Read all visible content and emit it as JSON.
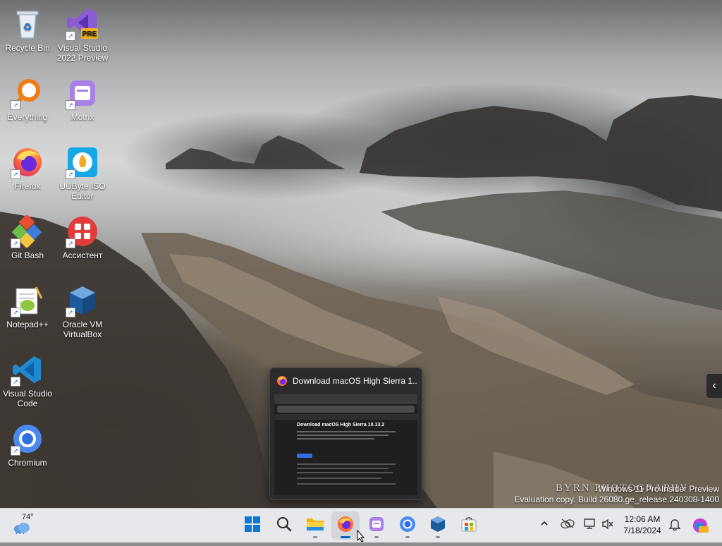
{
  "desktop": {
    "icons": [
      {
        "label": "Recycle Bin",
        "shortcut": false
      },
      {
        "label": "Visual Studio 2022 Preview",
        "shortcut": true,
        "badge": "PRE"
      },
      {
        "label": "Everything",
        "shortcut": true
      },
      {
        "label": "Motrix",
        "shortcut": true
      },
      {
        "label": "Firefox",
        "shortcut": true
      },
      {
        "label": "UUByte ISO Editor",
        "shortcut": true
      },
      {
        "label": "Git Bash",
        "shortcut": true
      },
      {
        "label": "Ассистент",
        "shortcut": true
      },
      {
        "label": "Notepad++",
        "shortcut": true
      },
      {
        "label": "Oracle VM VirtualBox",
        "shortcut": true
      },
      {
        "label": "Visual Studio Code",
        "shortcut": true
      },
      {
        "label": "Chromium",
        "shortcut": true
      }
    ]
  },
  "preview": {
    "title": "Download macOS High Sierra 1...",
    "page_heading": "Download macOS High Sierra 10.13.2",
    "app_icon": "firefox-icon"
  },
  "watermark": {
    "line1": "Windows 11 Pro Insider Preview",
    "line2": "Evaluation copy. Build 26080.ge_release.240308-1400",
    "photo_credit": "BYRN PHOTOGRAPHY"
  },
  "taskbar": {
    "weather_temp": "74°",
    "apps": [
      "start",
      "search",
      "file-explorer",
      "firefox",
      "motrix",
      "chromium",
      "virtualbox",
      "microsoft-store"
    ],
    "clock_time": "12:06 AM",
    "clock_date": "7/18/2024"
  },
  "colors": {
    "taskbar_bg": "#e6e8ec",
    "accent_blue": "#0067c0"
  }
}
